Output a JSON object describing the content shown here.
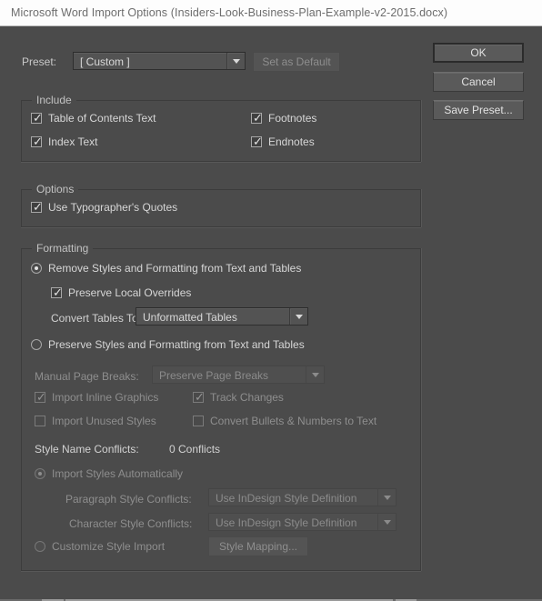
{
  "window": {
    "title": "Microsoft Word Import Options (Insiders-Look-Business-Plan-Example-v2-2015.docx)"
  },
  "preset": {
    "label": "Preset:",
    "value": "[ Custom ]",
    "set_as_default_label": "Set as Default"
  },
  "buttons": {
    "ok": "OK",
    "cancel": "Cancel",
    "save_preset": "Save Preset..."
  },
  "include": {
    "title": "Include",
    "items": [
      {
        "label": "Table of Contents Text",
        "checked": true
      },
      {
        "label": "Footnotes",
        "checked": true
      },
      {
        "label": "Index Text",
        "checked": true
      },
      {
        "label": "Endnotes",
        "checked": true
      }
    ]
  },
  "options": {
    "title": "Options",
    "items": [
      {
        "label": "Use Typographer's Quotes",
        "checked": true
      }
    ]
  },
  "formatting": {
    "title": "Formatting",
    "remove_styles_label": "Remove Styles and Formatting from Text and Tables",
    "preserve_local_overrides_label": "Preserve Local Overrides",
    "convert_tables_label": "Convert Tables To:",
    "convert_tables_value": "Unformatted Tables",
    "preserve_styles_label": "Preserve Styles and Formatting from Text and Tables",
    "manual_page_breaks_label": "Manual Page Breaks:",
    "manual_page_breaks_value": "Preserve Page Breaks",
    "import_inline_graphics_label": "Import Inline Graphics",
    "track_changes_label": "Track Changes",
    "import_unused_styles_label": "Import Unused Styles",
    "convert_bullets_label": "Convert Bullets & Numbers to Text",
    "style_name_conflicts_label": "Style Name Conflicts:",
    "style_name_conflicts_value": "0 Conflicts",
    "import_styles_auto_label": "Import Styles Automatically",
    "paragraph_style_conflicts_label": "Paragraph Style Conflicts:",
    "paragraph_style_conflicts_value": "Use InDesign Style Definition",
    "character_style_conflicts_label": "Character Style Conflicts:",
    "character_style_conflicts_value": "Use InDesign Style Definition",
    "customize_style_import_label": "Customize Style Import",
    "style_mapping_label": "Style Mapping..."
  },
  "colors": {
    "dialog_bg": "#4b4b4b",
    "titlebar_bg": "#fdfdfd",
    "text": "#d2d2d2",
    "text_disabled": "#8e8e8e"
  }
}
